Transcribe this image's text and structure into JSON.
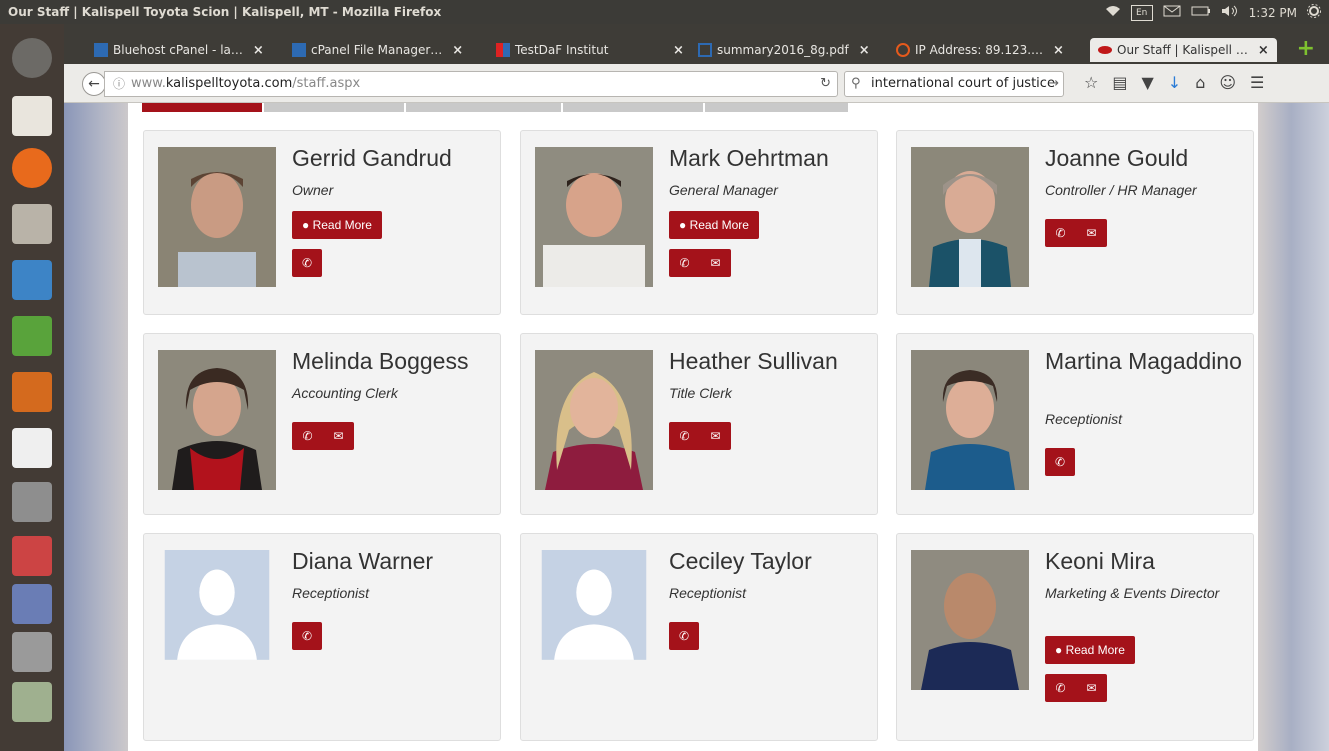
{
  "window": {
    "title": "Our Staff | Kalispell Toyota Scion | Kalispell, MT - Mozilla Firefox",
    "keyboard": "En",
    "time": "1:32 PM"
  },
  "tabs": [
    {
      "label": "Bluehost cPanel - la…"
    },
    {
      "label": "cPanel File Manager…"
    },
    {
      "label": "TestDaF Institut"
    },
    {
      "label": "summary2016_8g.pdf"
    },
    {
      "label": "IP Address: 89.123.…"
    },
    {
      "label": "Our Staff | Kalispell …"
    }
  ],
  "tab_close": "×",
  "newtab": "+",
  "url": {
    "prefix": "www.",
    "host": "kalispelltoyota.com",
    "path": "/staff.aspx"
  },
  "search": {
    "query": "international court of justice"
  },
  "buttons": {
    "read_more": "Read More"
  },
  "icons": {
    "phone": "✆",
    "email": "✉",
    "person": "👤"
  },
  "staff": [
    {
      "name": "Gerrid Gandrud",
      "role": "Owner",
      "read_more": true,
      "phone": true,
      "email": false
    },
    {
      "name": "Mark Oehrtman",
      "role": "General Manager",
      "read_more": true,
      "phone": true,
      "email": true
    },
    {
      "name": "Joanne Gould",
      "role": "Controller / HR Manager",
      "read_more": false,
      "phone": true,
      "email": true
    },
    {
      "name": "Melinda Boggess",
      "role": "Accounting Clerk",
      "read_more": false,
      "phone": true,
      "email": true
    },
    {
      "name": "Heather Sullivan",
      "role": "Title Clerk",
      "read_more": false,
      "phone": true,
      "email": true
    },
    {
      "name": "Martina Magaddino",
      "role": "Receptionist",
      "read_more": false,
      "phone": true,
      "email": false
    },
    {
      "name": "Diana Warner",
      "role": "Receptionist",
      "read_more": false,
      "phone": true,
      "email": false
    },
    {
      "name": "Ceciley Taylor",
      "role": "Receptionist",
      "read_more": false,
      "phone": true,
      "email": false
    },
    {
      "name": "Keoni Mira",
      "role": "Marketing & Events Director",
      "read_more": true,
      "phone": true,
      "email": true
    }
  ],
  "colors": {
    "accent": "#a4121a",
    "card_bg": "#f3f3f3"
  }
}
